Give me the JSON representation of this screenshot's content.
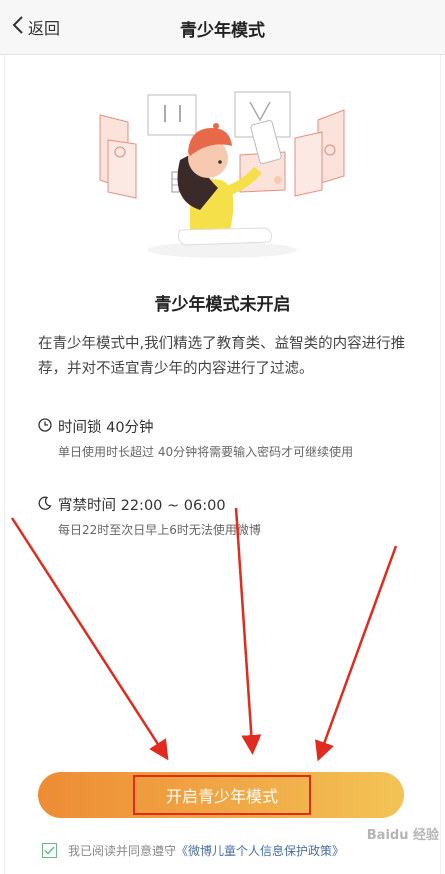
{
  "nav": {
    "back_label": "返回",
    "title": "青少年模式"
  },
  "status": {
    "title": "青少年模式未开启"
  },
  "description": "在青少年模式中,我们精选了教育类、益智类的内容进行推荐，并对不适宜青少年的内容进行了过滤。",
  "features": [
    {
      "icon": "clock-icon",
      "title": "时间锁 40分钟",
      "detail": "单日使用时长超过 40分钟将需要输入密码才可继续使用"
    },
    {
      "icon": "moon-icon",
      "title": "宵禁时间 22:00 ~ 06:00",
      "detail": "每日22时至次日早上6时无法使用微博"
    }
  ],
  "cta": {
    "label": "开启青少年模式"
  },
  "agreement": {
    "prefix": "我已阅读并同意遵守",
    "link": "《微博儿童个人信息保护政策》",
    "checked": true
  },
  "watermark": "Baidu 经验",
  "colors": {
    "cta_start": "#ed8c34",
    "cta_end": "#f2c455",
    "annotation_red": "#e12b1e",
    "link": "#4a6fa5"
  }
}
